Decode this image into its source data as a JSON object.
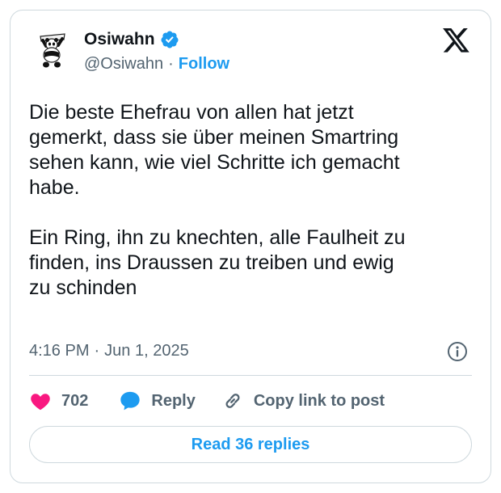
{
  "tweet": {
    "author": {
      "name": "Osiwahn",
      "handle": "@Osiwahn",
      "follow_label": "Follow",
      "verified": true
    },
    "text": "Die beste Ehefrau von allen hat jetzt\ngemerkt, dass sie über meinen Smartring\nsehen kann, wie viel Schritte ich gemacht\nhabe.\n\nEin Ring, ihn zu knechten, alle Faulheit zu\nfinden, ins Draussen zu treiben und ewig\nzu schinden",
    "time": "4:16 PM",
    "date": "Jun 1, 2025",
    "meta_separator": "·",
    "likes": "702",
    "reply_label": "Reply",
    "copy_link_label": "Copy link to post",
    "read_replies_label": "Read 36 replies"
  },
  "icons": {
    "brand": "x-logo-icon",
    "verified": "verified-badge-icon",
    "info": "info-icon",
    "like": "heart-icon",
    "reply": "speech-bubble-icon",
    "link": "link-icon"
  },
  "colors": {
    "accent": "#1d9bf0",
    "like": "#f91880",
    "text": "#0f1419",
    "muted": "#536471",
    "border": "#cfd9de"
  }
}
